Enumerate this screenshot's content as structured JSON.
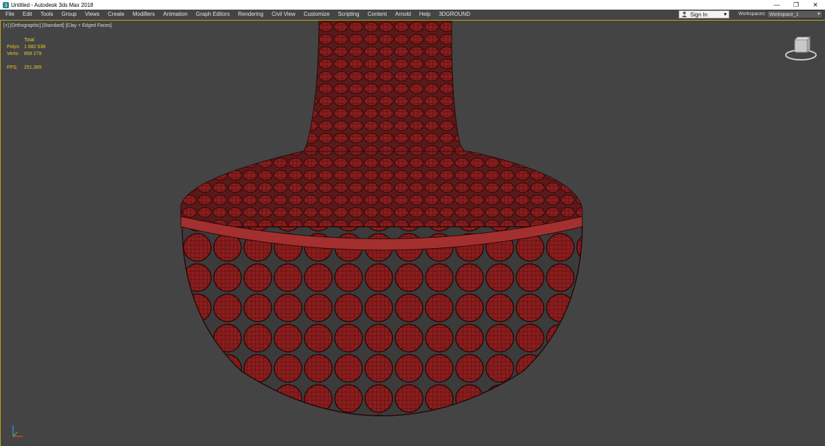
{
  "window": {
    "title": "Untitled - Autodesk 3ds Max 2018",
    "app_icon": "3dsmax-icon",
    "controls": {
      "minimize": "—",
      "restore": "❐",
      "close": "✕"
    }
  },
  "menubar": {
    "items": [
      "File",
      "Edit",
      "Tools",
      "Group",
      "Views",
      "Create",
      "Modifiers",
      "Animation",
      "Graph Editors",
      "Rendering",
      "Civil View",
      "Customize",
      "Scripting",
      "Content",
      "Arnold",
      "Help",
      "3DGROUND"
    ]
  },
  "account": {
    "signin_label": "Sign In",
    "icon": "user-icon"
  },
  "workspaces": {
    "label": "Workspaces:",
    "value": "Workspace_1"
  },
  "viewport": {
    "label": "[+] [Orthographic] [Standard] [Clay + Edged Faces]",
    "stats": {
      "header": "Total",
      "polys_label": "Polys:",
      "polys_value": "1 682 638",
      "verts_label": "Verts:",
      "verts_value": "858 279",
      "fps_label": "FPS:",
      "fps_value": "251,389"
    },
    "viewcube_icon": "viewcube-icon",
    "axis_icon": "axis-tripod-icon",
    "colors": {
      "background": "#444444",
      "mesh": "#8b1d1d",
      "wire": "#3a0a0a",
      "highlight": "#c9a818"
    }
  }
}
